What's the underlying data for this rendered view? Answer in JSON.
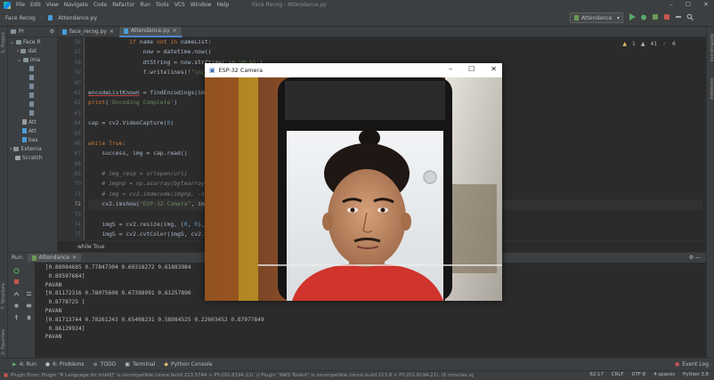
{
  "menubar": {
    "items": [
      "File",
      "Edit",
      "View",
      "Navigate",
      "Code",
      "Refactor",
      "Run",
      "Tools",
      "VCS",
      "Window",
      "Help"
    ],
    "window_title": "Face Recog - Attendance.py",
    "controls": [
      "–",
      "☐",
      "✕"
    ]
  },
  "navbar": {
    "project": "Face Recog",
    "file": "Attendance.py",
    "run_config": "Attendance"
  },
  "left_strip": {
    "project": "1: Project",
    "structure": "7: Structure",
    "favorites": "2: Favorites"
  },
  "right_strip": {
    "notifications": "Notifications",
    "database": "Database"
  },
  "project_panel": {
    "header": "Pr",
    "nodes": [
      "Face R",
      "dat",
      "ima",
      "",
      "",
      "",
      "",
      "",
      "",
      "Att",
      "Att",
      "bas",
      "Externa",
      "Scratch"
    ]
  },
  "tabs": [
    {
      "label": "face_recog.py",
      "active": false
    },
    {
      "label": "Attendance.py",
      "active": true
    }
  ],
  "editor": {
    "inspections": {
      "warnings": "1",
      "weak": "41",
      "typos": "6"
    },
    "breadcrumb": "while True",
    "line_numbers": [
      "56",
      "57",
      "58",
      "59",
      "60",
      "61",
      "62",
      "63",
      "64",
      "65",
      "66",
      "67",
      "68",
      "69",
      "70",
      "71",
      "72",
      "73",
      "74",
      "75"
    ],
    "current_line": "62"
  },
  "run_panel": {
    "label": "Run:",
    "tab": "Attendance",
    "output": [
      " [0.88084685 0.77847304 0.69318272 0.61883984",
      "  0.89597684]",
      " PAVAN",
      " [0.81172316 0.78075608 0.67398991 0.61257890",
      "  0.8778725 ]",
      " PAVAN",
      " [0.81713744 0.78261243 0.65408231 0.58984525 0.22603452 0.87977849",
      "  0.86129924]",
      " PAVAN",
      " "
    ]
  },
  "bottom_tabs": [
    "4: Run",
    "6: Problems",
    "TODO",
    "Terminal",
    "Python Console"
  ],
  "event_log": "Event Log",
  "status": {
    "message": "Plugin Error: Plugin \"R Language for IntelliJ\" is incompatible (since build 213.5744 > PY-202.8194.22). // Plugin \"AWS Toolkit\" is incompatible (since build 213.8 > PY-202.8194.22). (6 minutes ago)",
    "position": "62:17",
    "line_sep": "CRLF",
    "encoding": "UTF-8",
    "indent": "4 spaces",
    "interpreter": "Python 3.8"
  },
  "camera_window": {
    "title": "ESP-32 Camera",
    "controls": [
      "–",
      "☐",
      "✕"
    ]
  },
  "colors": {
    "accent": "#4a88c7",
    "keyword": "#cc7832",
    "string": "#6a8759",
    "number": "#6897bb",
    "error": "#bc3f3c"
  }
}
